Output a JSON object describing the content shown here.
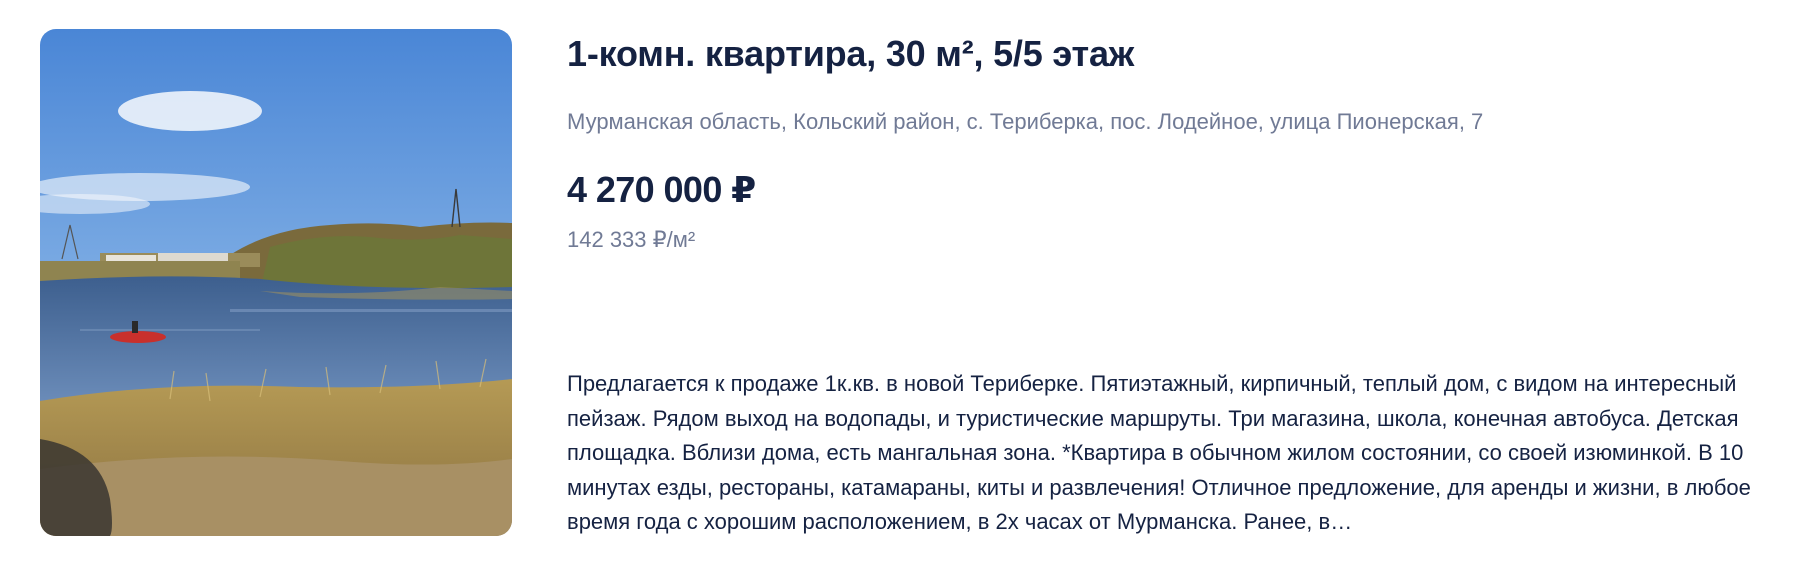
{
  "listing": {
    "title": "1-комн. квартира, 30 м², 5/5 этаж",
    "address": "Мурманская область, Кольский район, с. Териберка, пос. Лодейное, улица Пионерская, 7",
    "price": "4 270 000 ₽",
    "price_per_meter": "142 333 ₽/м²",
    "description": "Предлагается к продаже 1к.кв. в новой Териберке. Пятиэтажный, кирпичный, теплый дом, с видом на интересный пейзаж. Рядом выход на водопады, и туристические маршруты. Три магазина, школа, конечная автобуса. Детская площадка. Вблизи дома, есть мангальная зона. *Квартира в обычном жилом состоянии, со своей изюминкой. В 10 минутах езды, рестораны, катамараны, киты и развлечения! Отличное предложение, для аренды и жизни, в любое время года с хорошим расположением, в 2х часах от Мурманска. Ранее, в…"
  }
}
